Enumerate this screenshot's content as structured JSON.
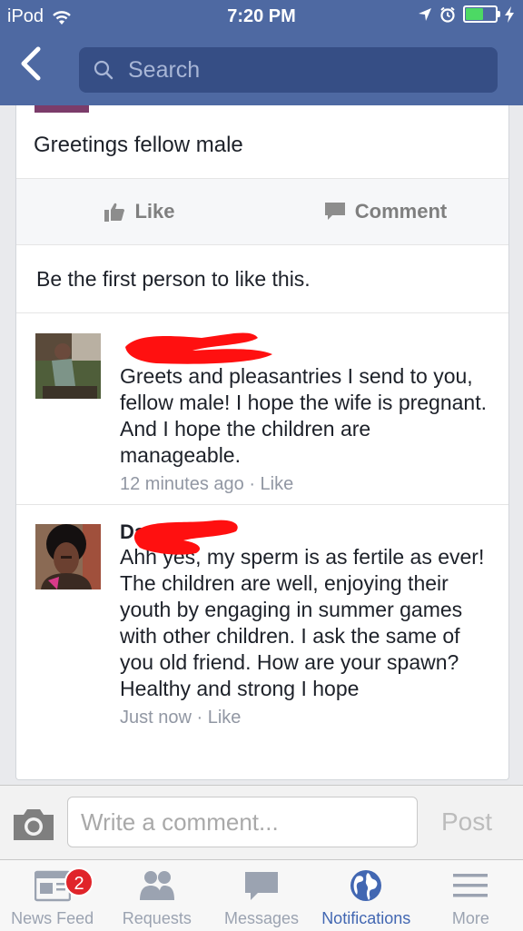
{
  "status_bar": {
    "device": "iPod",
    "time": "7:20 PM"
  },
  "nav": {
    "search_placeholder": "Search"
  },
  "post": {
    "text": "Greetings fellow male",
    "like_label": "Like",
    "comment_label": "Comment",
    "likes_summary": "Be the first person to like this."
  },
  "comments": [
    {
      "name": "",
      "text": "Greets and pleasantries I send to you, fellow male! I hope the wife is pregnant. And I hope the children are manageable.",
      "time": "12 minutes ago",
      "sep": " · ",
      "like": "Like"
    },
    {
      "name": "Da",
      "text": "Ahh yes, my sperm is as fertile as ever! The children are well, enjoying their youth by engaging in summer games with other children. I ask the same of you old friend. How are your spawn? Healthy and strong I hope",
      "time": "Just now",
      "sep": " · ",
      "like": "Like"
    }
  ],
  "composer": {
    "placeholder": "Write a comment...",
    "post_label": "Post"
  },
  "tabbar": {
    "tabs": [
      {
        "label": "News Feed",
        "icon": "news-feed-icon",
        "badge": "2"
      },
      {
        "label": "Requests",
        "icon": "friend-requests-icon"
      },
      {
        "label": "Messages",
        "icon": "messages-icon"
      },
      {
        "label": "Notifications",
        "icon": "globe-icon",
        "active": true
      },
      {
        "label": "More",
        "icon": "menu-icon"
      }
    ]
  },
  "colors": {
    "brand": "#4e69a2",
    "active_tab": "#4267b2",
    "badge": "#e0242a",
    "redaction": "#ff0000"
  }
}
